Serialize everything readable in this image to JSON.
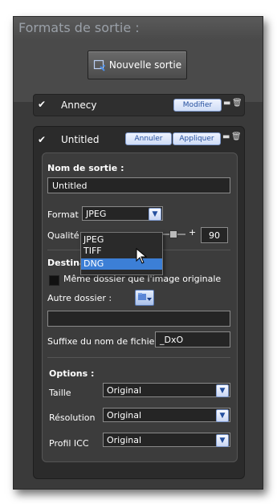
{
  "window": {
    "title": "Formats de sortie :",
    "new_output_label": "Nouvelle sortie"
  },
  "outputs": [
    {
      "name": "Annecy",
      "checked": true,
      "buttons": [
        "Modifier"
      ]
    },
    {
      "name": "Untitled",
      "checked": true,
      "buttons": [
        "Annuler",
        "Appliquer"
      ]
    }
  ],
  "editor": {
    "output_name_label": "Nom de sortie :",
    "output_name_value": "Untitled",
    "format_label": "Format :",
    "format_value": "JPEG",
    "format_options": [
      "JPEG",
      "TIFF",
      "DNG"
    ],
    "format_highlighted": "DNG",
    "quality_label": "Qualité :",
    "quality_plus": "+",
    "quality_value": "90",
    "destination_label": "Destination",
    "same_folder_label": "Même dossier que l'image originale",
    "same_folder_checked": false,
    "other_folder_label": "Autre dossier :",
    "other_folder_value": "",
    "suffix_label": "Suffixe du nom de fichier",
    "suffix_value": "_DxO",
    "options_label": "Options :",
    "size_label": "Taille",
    "size_value": "Original",
    "resolution_label": "Résolution",
    "resolution_value": "Original",
    "icc_label": "Profil ICC",
    "icc_value": "Original"
  },
  "icons": {
    "new_output": "new-output-icon",
    "trash": "trash-icon",
    "minus": "minus-icon",
    "folder": "folder-icon",
    "chevron": "chevron-down-icon",
    "cursor": "mouse-pointer-icon"
  },
  "colors": {
    "highlight": "#3c7fd6",
    "panel": "#3a3a3a",
    "pill_text": "#244f9e"
  }
}
